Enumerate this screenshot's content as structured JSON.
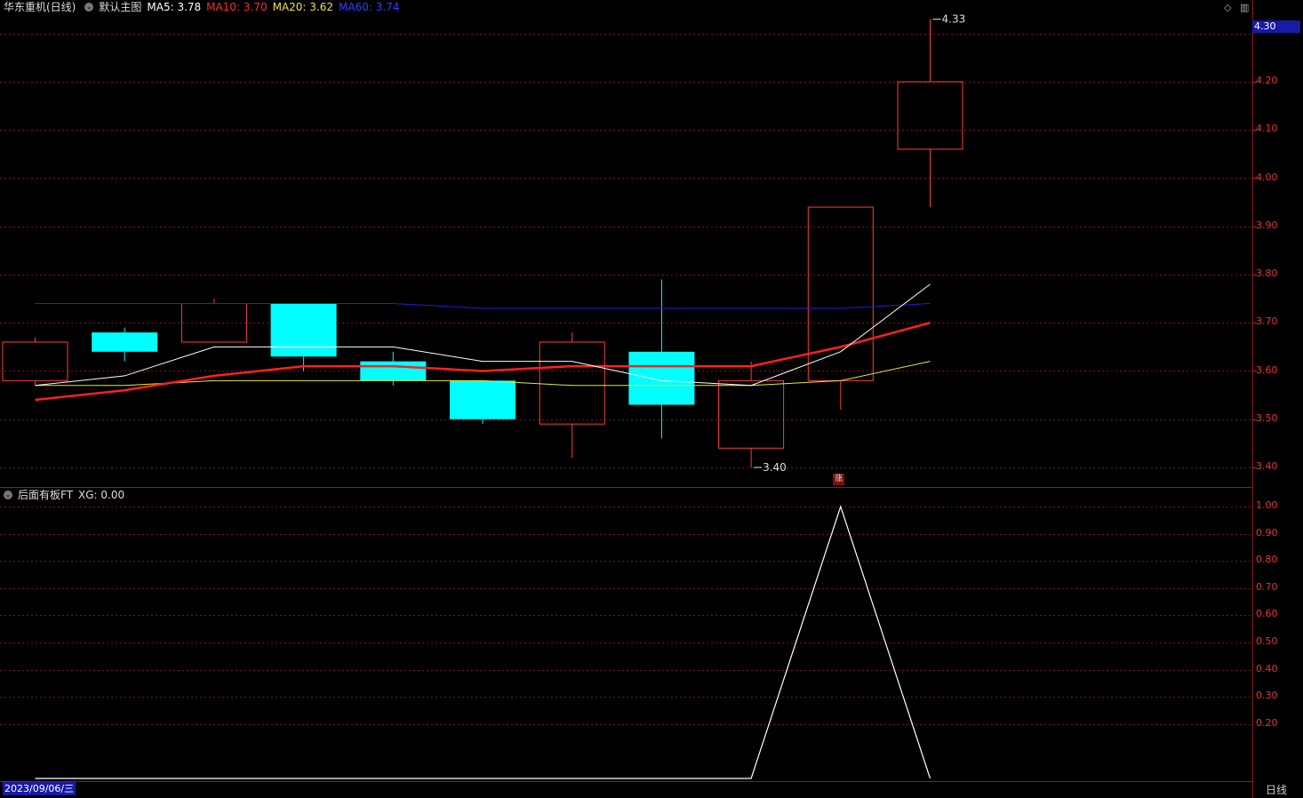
{
  "header": {
    "stock_name": "华东重机(日线)",
    "main_chart_label": "默认主图",
    "ma5": "MA5: 3.78",
    "ma10": "MA10: 3.70",
    "ma20": "MA20: 3.62",
    "ma60": "MA60: 3.74"
  },
  "sub_header": {
    "indicator_name": "后面有板FT",
    "xg_value": "XG: 0.00"
  },
  "current_price": "4.30",
  "date_label": "2023/09/06/三",
  "period_label": "日线",
  "zhang_marker": "涨",
  "colors": {
    "up": "#ff3c3c",
    "down": "#00ffff",
    "ma5": "#ffffff",
    "ma10": "#ff2020",
    "ma20": "#e8e830",
    "ma60": "#2020e0",
    "grid": "#7a1818"
  },
  "chart_data": [
    {
      "type": "candlestick",
      "y_ticks": [
        "4.20",
        "4.10",
        "4.00",
        "3.90",
        "3.80",
        "3.70",
        "3.60",
        "3.50",
        "3.40"
      ],
      "candles": [
        {
          "open": 3.58,
          "close": 3.66,
          "high": 3.67,
          "low": 3.57
        },
        {
          "open": 3.68,
          "close": 3.64,
          "high": 3.69,
          "low": 3.62
        },
        {
          "open": 3.66,
          "close": 3.74,
          "high": 3.75,
          "low": 3.66
        },
        {
          "open": 3.74,
          "close": 3.63,
          "high": 3.74,
          "low": 3.6
        },
        {
          "open": 3.62,
          "close": 3.58,
          "high": 3.64,
          "low": 3.57
        },
        {
          "open": 3.58,
          "close": 3.5,
          "high": 3.58,
          "low": 3.49
        },
        {
          "open": 3.49,
          "close": 3.66,
          "high": 3.68,
          "low": 3.42
        },
        {
          "open": 3.64,
          "close": 3.53,
          "high": 3.79,
          "low": 3.46
        },
        {
          "open": 3.44,
          "close": 3.58,
          "high": 3.62,
          "low": 3.4
        },
        {
          "open": 3.58,
          "close": 3.94,
          "high": 3.94,
          "low": 3.52
        },
        {
          "open": 4.06,
          "close": 4.2,
          "high": 4.33,
          "low": 3.94
        }
      ],
      "ma5": [
        3.57,
        3.59,
        3.65,
        3.65,
        3.65,
        3.62,
        3.62,
        3.58,
        3.57,
        3.64,
        3.78
      ],
      "ma10": [
        3.54,
        3.56,
        3.59,
        3.61,
        3.61,
        3.6,
        3.61,
        3.61,
        3.61,
        3.65,
        3.7
      ],
      "ma20": [
        3.57,
        3.57,
        3.58,
        3.58,
        3.58,
        3.58,
        3.57,
        3.57,
        3.57,
        3.58,
        3.62
      ],
      "ma60": [
        3.74,
        3.74,
        3.74,
        3.74,
        3.74,
        3.73,
        3.73,
        3.73,
        3.73,
        3.73,
        3.74
      ],
      "annotations": [
        {
          "candle": 10,
          "value": 4.33,
          "label": "4.33"
        },
        {
          "candle": 8,
          "value": 3.4,
          "label": "3.40"
        }
      ]
    },
    {
      "type": "line",
      "y_ticks": [
        "1.00",
        "0.90",
        "0.80",
        "0.70",
        "0.60",
        "0.50",
        "0.40",
        "0.30",
        "0.20"
      ],
      "ylim": [
        0,
        1
      ],
      "values": [
        0,
        0,
        0,
        0,
        0,
        0,
        0,
        0,
        0,
        1,
        0
      ]
    }
  ]
}
